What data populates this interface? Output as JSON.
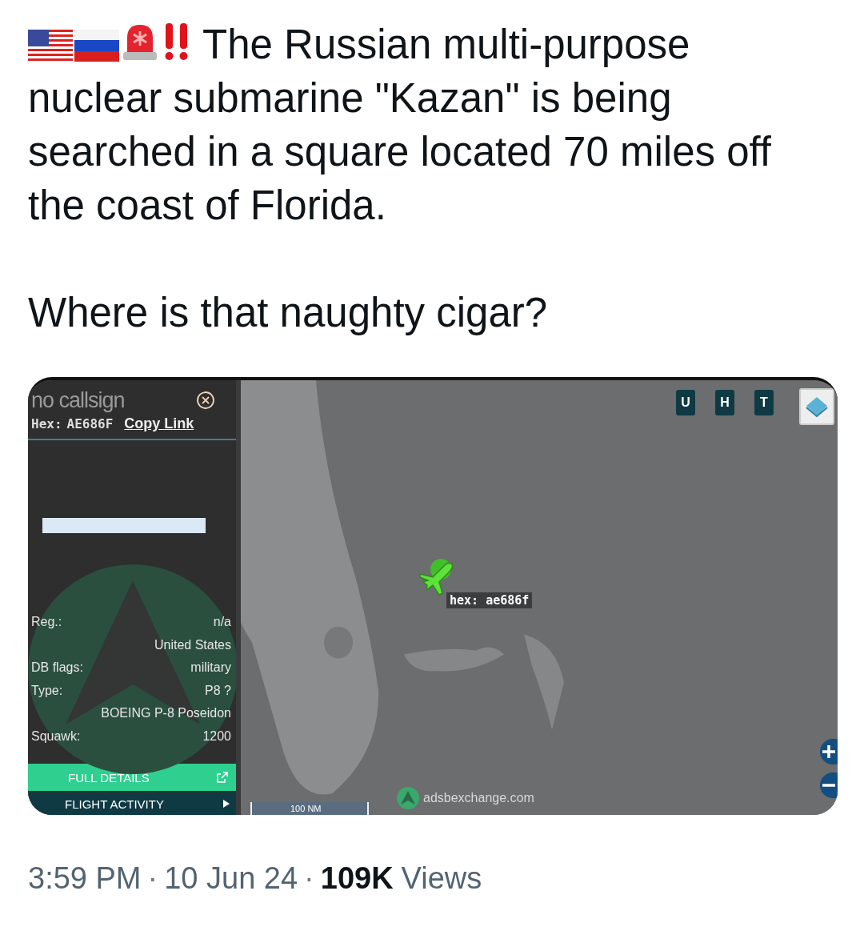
{
  "post": {
    "emojis": [
      {
        "kind": "us_flag"
      },
      {
        "kind": "ru_flag"
      },
      {
        "kind": "siren"
      },
      {
        "kind": "double_exclamation"
      }
    ],
    "paragraphs": [
      [
        "The Russian multi-purpose",
        "nuclear submarine \"Kazan\" is being",
        "searched in a square located 70 miles off",
        "the coast of Florida."
      ],
      [
        "Where is that naughty cigar?"
      ]
    ]
  },
  "embed": {
    "sidebar": {
      "callsign": "no callsign",
      "hex_label": "Hex:",
      "hex_value": "AE686F",
      "copy_link": "Copy Link",
      "fields": [
        {
          "label": "Reg.:",
          "value": "n/a"
        },
        {
          "value": "United States"
        },
        {
          "label": "DB flags:",
          "value": "military"
        },
        {
          "label": "Type:",
          "value": "P8 ?"
        },
        {
          "value": "BOEING P-8 Poseidon"
        },
        {
          "label": "Squawk:",
          "value": "1200"
        }
      ],
      "full_details": "FULL DETAILS",
      "flight_activity": "FLIGHT ACTIVITY"
    },
    "map": {
      "kind": "picture",
      "aircraft_label": "hex: ae686f",
      "layer_buttons": [
        "U",
        "H",
        "T"
      ],
      "scale": "100 NM",
      "attribution": "adsbexchange.com"
    }
  },
  "meta": [
    {
      "kind": "text",
      "text": "3:59 PM"
    },
    {
      "kind": "sep",
      "text": "·"
    },
    {
      "kind": "text",
      "text": "10 Jun 24"
    },
    {
      "kind": "sep",
      "text": "·"
    },
    {
      "kind": "count",
      "text": "109K"
    },
    {
      "kind": "text",
      "text": "Views"
    }
  ]
}
